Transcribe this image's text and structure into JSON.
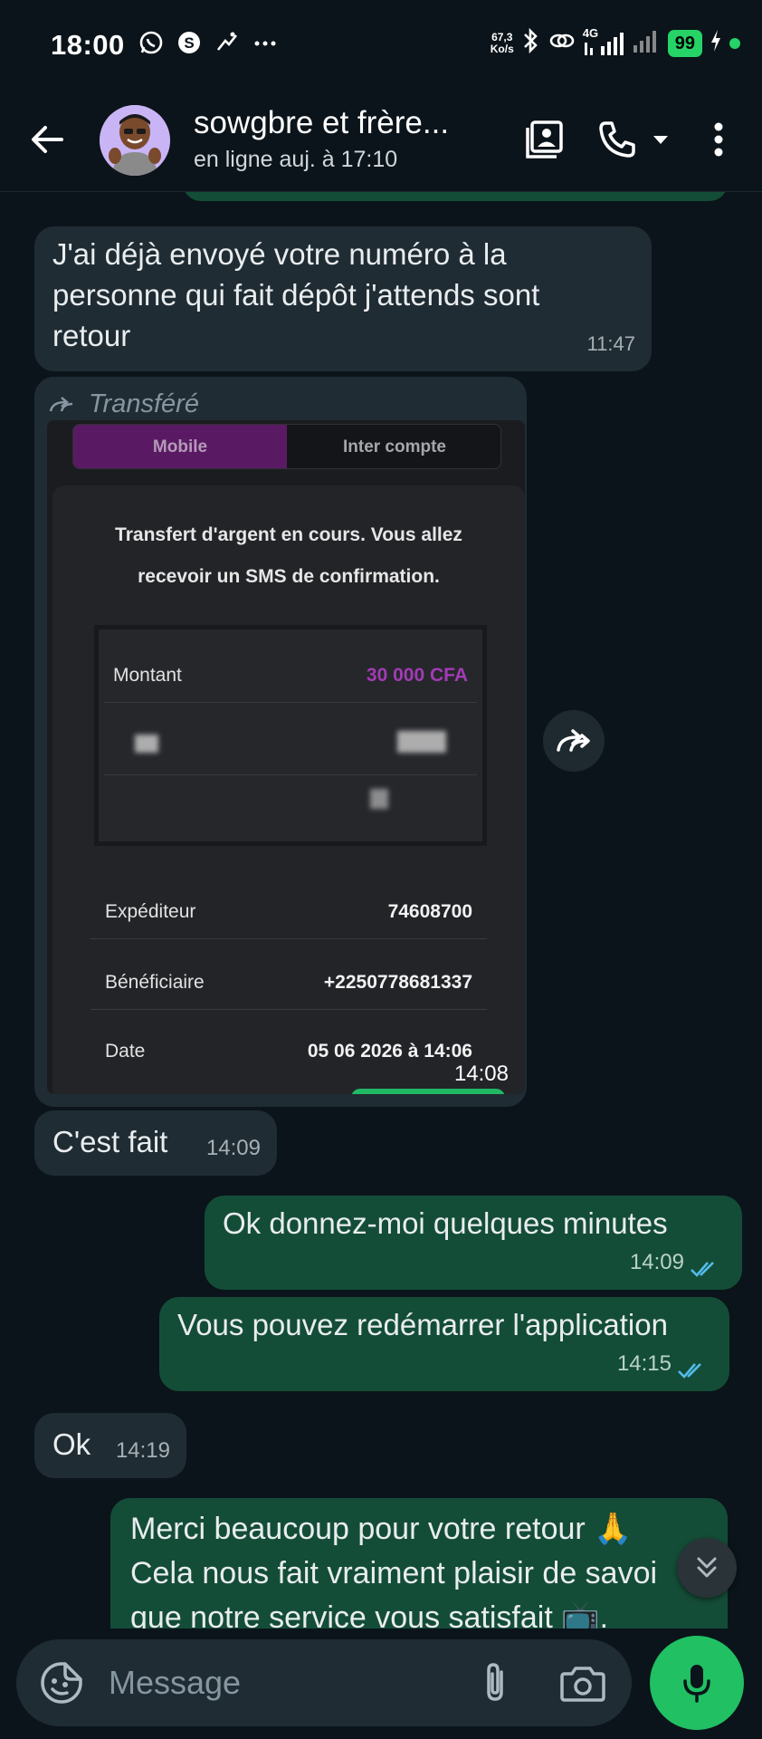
{
  "status_bar": {
    "time": "18:00",
    "left_icons": [
      "whatsapp-icon",
      "skype-icon",
      "activity-icon",
      "more-dots-icon"
    ],
    "net_speed_value": "67,3",
    "net_speed_unit": "Ko/s",
    "network": "4G",
    "battery": "99"
  },
  "header": {
    "title": "sowgbre et frère...",
    "subtitle": "en ligne auj. à 17:10"
  },
  "messages": {
    "m1": {
      "text": "J'ai déjà envoyé votre numéro à la personne qui fait dépôt j'attends sont retour",
      "time": "11:47"
    },
    "m2": {
      "forwarded_label": "Transféré",
      "time": "14:08",
      "screenshot": {
        "tab_mobile": "Mobile",
        "tab_inter": "Inter compte",
        "message": "Transfert d'argent en cours. Vous allez recevoir un SMS de confirmation.",
        "amount_label": "Montant",
        "amount_value": "30 000 CFA",
        "sender_label": "Expéditeur",
        "sender_value": "74608700",
        "beneficiary_label": "Bénéficiaire",
        "beneficiary_value": "+2250778681337",
        "date_label": "Date",
        "date_value": "05 06 2026 à 14:06"
      }
    },
    "m3": {
      "text": "C'est fait",
      "time": "14:09"
    },
    "m4": {
      "text": "Ok donnez-moi quelques minutes",
      "time": "14:09"
    },
    "m5": {
      "text": "Vous pouvez redémarrer l'application",
      "time": "14:15"
    },
    "m6": {
      "text": "Ok",
      "time": "14:19"
    },
    "m7": {
      "line1": "Merci beaucoup pour votre retour 🙏",
      "line2": "Cela nous fait vraiment plaisir de savoi",
      "line3": "que notre service vous satisfait 📺."
    }
  },
  "input": {
    "placeholder": "Message"
  },
  "colors": {
    "background": "#0b141a",
    "incoming_bubble": "#202c33",
    "outgoing_bubble": "#144d37",
    "accent_green": "#21c063",
    "read_ticks": "#53bdeb",
    "amount_purple": "#a23bb5"
  }
}
